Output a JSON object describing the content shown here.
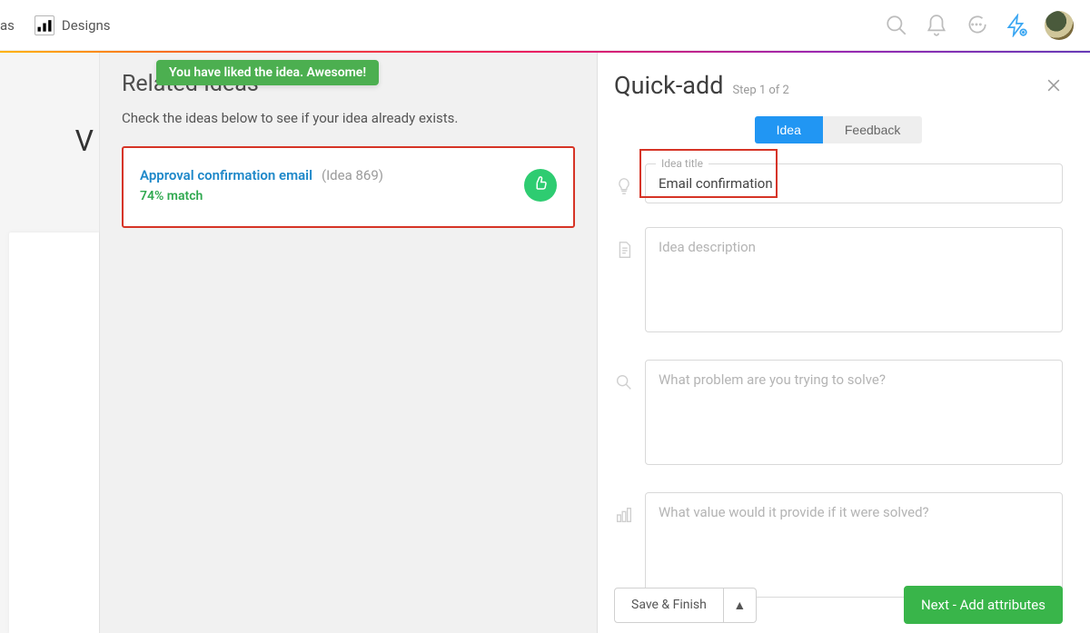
{
  "topbar": {
    "nav": [
      {
        "short": "as",
        "label": ""
      },
      {
        "short": "",
        "label": "Designs"
      }
    ]
  },
  "toast": {
    "message": "You have liked the idea. Awesome!"
  },
  "left": {
    "heading": "Related Ideas",
    "subtitle": "Check the ideas below to see if your idea already exists.",
    "idea": {
      "title": "Approval confirmation email",
      "id_label": "(Idea 869)",
      "match": "74% match"
    }
  },
  "right": {
    "title": "Quick-add",
    "step": "Step 1 of 2",
    "tabs": {
      "idea": "Idea",
      "feedback": "Feedback"
    },
    "fields": {
      "title_label": "Idea title",
      "title_value": "Email confirmation",
      "desc_placeholder": "Idea description",
      "problem_placeholder": "What problem are you trying to solve?",
      "value_placeholder": "What value would it provide if it were solved?"
    },
    "footer": {
      "save": "Save & Finish",
      "caret": "▲",
      "next": "Next - Add attributes"
    }
  },
  "bg_char": "V"
}
